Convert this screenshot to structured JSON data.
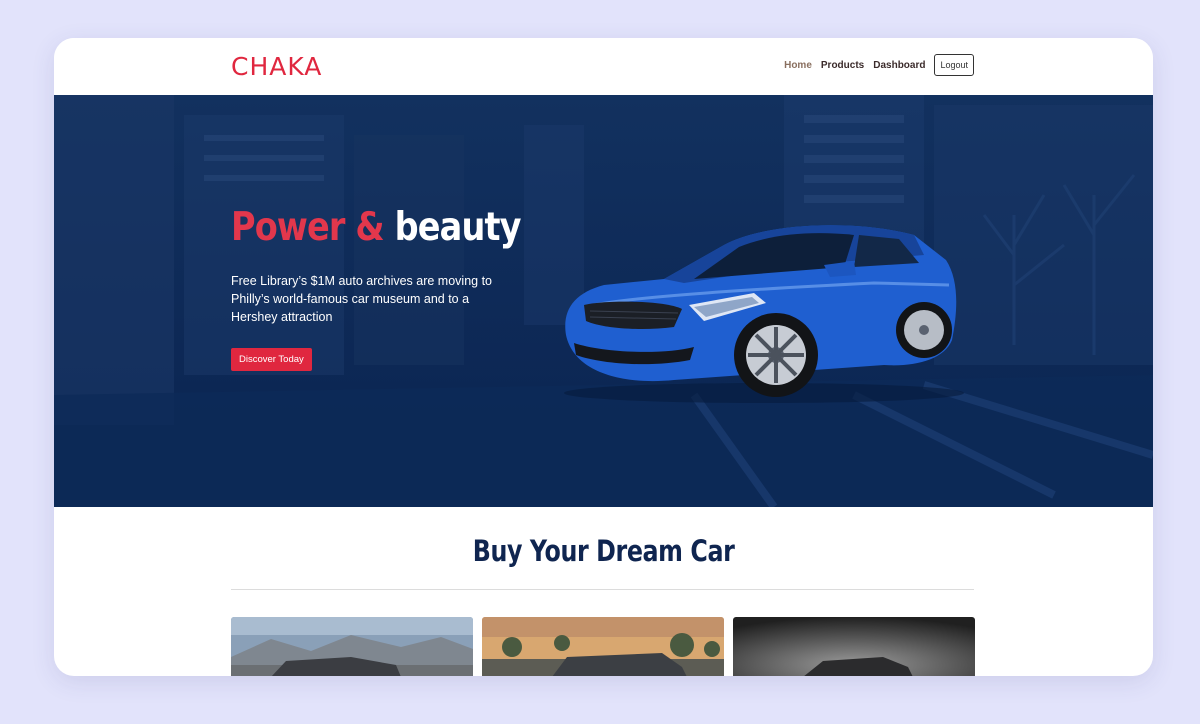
{
  "header": {
    "logo": "CHAKA",
    "nav": {
      "home": "Home",
      "products": "Products",
      "dashboard": "Dashboard",
      "logout": "Logout"
    }
  },
  "hero": {
    "title_part1": "Power &",
    "title_part2": "beauty",
    "description": "Free Library’s $1M auto archives are moving to Philly’s world-famous car museum and to a Hershey attraction",
    "button": "Discover Today"
  },
  "section": {
    "title": "Buy Your Dream Car"
  },
  "colors": {
    "brand_red": "#e0273f",
    "hero_navy": "#0b2550",
    "page_bg": "#e2e3fb"
  }
}
